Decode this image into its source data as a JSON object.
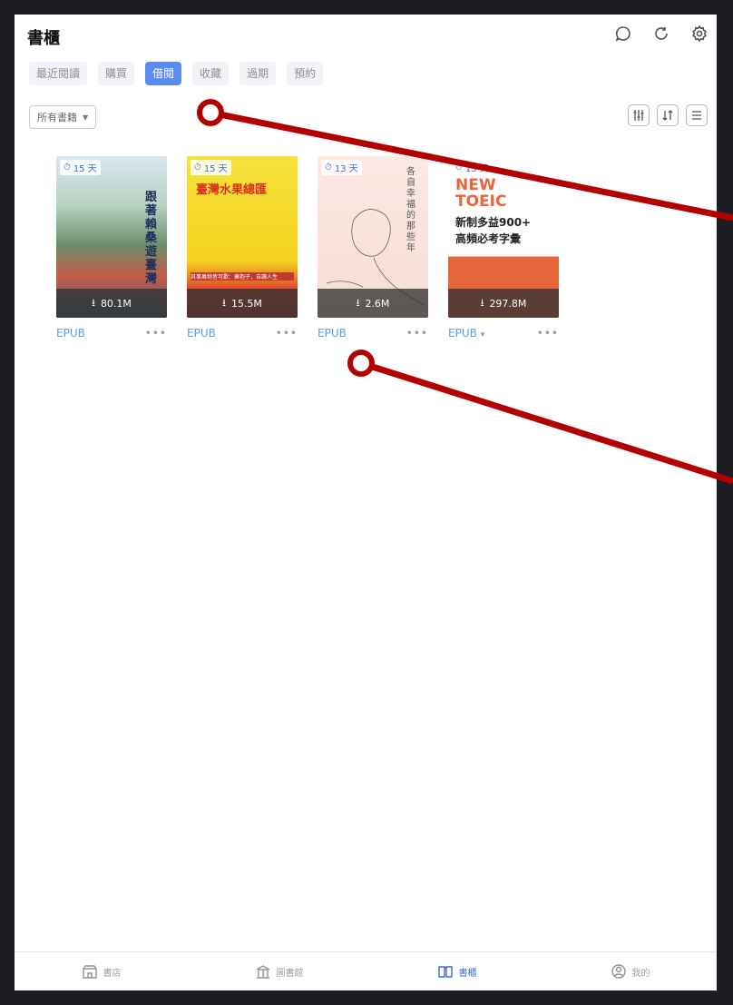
{
  "header": {
    "title": "書櫃",
    "icons": [
      "chat-icon",
      "refresh-icon",
      "settings-icon"
    ]
  },
  "tabs": [
    {
      "label": "最近閱讀",
      "active": false
    },
    {
      "label": "購買",
      "active": false
    },
    {
      "label": "借閱",
      "active": true
    },
    {
      "label": "收藏",
      "active": false
    },
    {
      "label": "過期",
      "active": false
    },
    {
      "label": "預約",
      "active": false
    }
  ],
  "filter": {
    "label": "所有書籍"
  },
  "toolbar": {
    "icons": [
      "filter-sliders-icon",
      "sort-icon",
      "list-view-icon"
    ]
  },
  "books": [
    {
      "days": "15 天",
      "size": "80.1M",
      "format": "EPUB",
      "more": "•••",
      "cover_title": "跟著賴桑遊臺灣"
    },
    {
      "days": "15 天",
      "size": "15.5M",
      "format": "EPUB",
      "more": "•••",
      "cover_title": "臺灣水果總匯",
      "cover_sub": "其事萬物皆可歡：擁抱子，自讀人生"
    },
    {
      "days": "13 天",
      "size": "2.6M",
      "format": "EPUB",
      "more": "•••",
      "cover_title": "各自幸福的那些年"
    },
    {
      "days": "15 天",
      "size": "297.8M",
      "format": "EPUB",
      "format_caret": "▾",
      "more": "•••",
      "cover_title_1": "NEW",
      "cover_title_2": "TOEIC",
      "cover_title_3": "新制多益900+",
      "cover_title_4": "高頻必考字彙"
    }
  ],
  "bottom_nav": [
    {
      "label": "書店",
      "icon": "store-icon",
      "active": false
    },
    {
      "label": "圖書館",
      "icon": "library-icon",
      "active": false
    },
    {
      "label": "書櫃",
      "icon": "book-icon",
      "active": true
    },
    {
      "label": "我的",
      "icon": "profile-icon",
      "active": false
    }
  ],
  "colors": {
    "accent": "#5b8df0",
    "format_text": "#5aa2e6",
    "annotation": "#b30000"
  }
}
